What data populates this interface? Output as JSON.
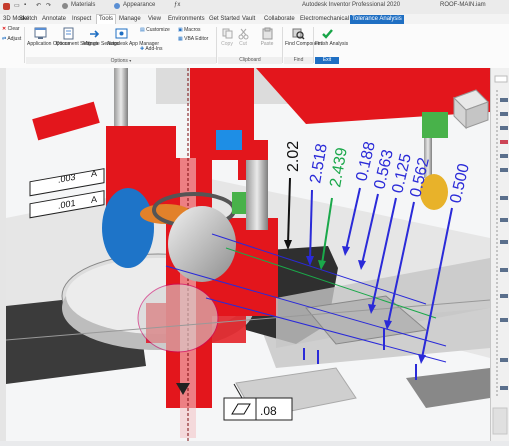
{
  "titlebar": {
    "qat_materials": "Materials",
    "qat_appearance": "Appearance",
    "app_title": "Autodesk Inventor Professional 2020",
    "doc_name": "ROOF-MAIN.iam"
  },
  "menubar": {
    "tabs": [
      "3D Model",
      "Sketch",
      "Annotate",
      "Inspect",
      "Tools",
      "Manage",
      "View",
      "Environments",
      "Get Started",
      "Vault",
      "Collaborate",
      "Electromechanical",
      "Tolerance Analysis"
    ],
    "active": "Tools"
  },
  "ribbon": {
    "clear_label": "Clear",
    "adjust_label": "Adjust",
    "app_options_label": "Application Options",
    "doc_settings_label": "Document Settings",
    "migrate_label": "Migrate Settings",
    "app_manager_label": "Autodesk App Manager",
    "customize_label": "Customize",
    "macros_label": "Macros",
    "vba_label": "VBA Editor",
    "addins_label": "Add-Ins",
    "copy_label": "Copy",
    "cut_label": "Cut",
    "paste_label": "Paste",
    "find_component_label": "Find Component",
    "finish_analysis_label": "Finish Analysis",
    "options_group": "Options",
    "clipboard_group": "Clipboard",
    "find_group": "Find",
    "exit_group": "Exit"
  },
  "dimensions": [
    "2.02",
    "2.518",
    "2.439",
    "0.188",
    "0.563",
    "0.125",
    "0.562",
    "0.500"
  ],
  "dim_colors": {
    "2.02": "#111111",
    "2.518": "#2a2ad8",
    "2.439": "#1aa84a",
    "0.188": "#2a2ad8",
    "0.563": "#2a2ad8",
    "0.125": "#2a2ad8",
    "0.562": "#2a2ad8",
    "0.500": "#2a2ad8"
  },
  "annotations": {
    "tol1": ".003",
    "ref1": "A",
    "tol2": ".001",
    "ref2": "A",
    "flatness": ".08"
  },
  "colors": {
    "red": "#e3161c",
    "blue_dim": "#2a2ad8",
    "active_tab": "#1f6fc3"
  }
}
